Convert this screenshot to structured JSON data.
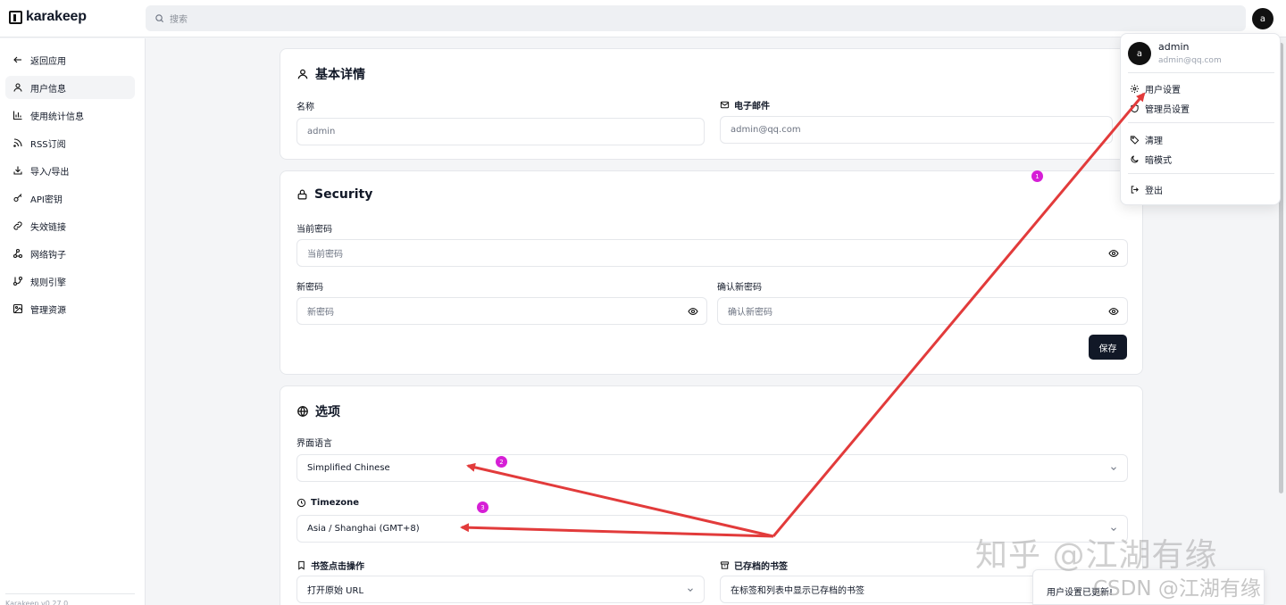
{
  "app": {
    "name": "karakeep"
  },
  "search": {
    "placeholder": "搜索"
  },
  "user": {
    "initial": "a",
    "name": "admin",
    "email": "admin@qq.com"
  },
  "sidebar": {
    "items": [
      {
        "label": "返回应用",
        "icon": "arrow-left-icon"
      },
      {
        "label": "用户信息",
        "icon": "user-icon",
        "active": true
      },
      {
        "label": "使用统计信息",
        "icon": "bar-chart-icon"
      },
      {
        "label": "RSS订阅",
        "icon": "rss-icon"
      },
      {
        "label": "导入/导出",
        "icon": "download-icon"
      },
      {
        "label": "API密钥",
        "icon": "key-icon"
      },
      {
        "label": "失效链接",
        "icon": "link-icon"
      },
      {
        "label": "网络钩子",
        "icon": "webhook-icon"
      },
      {
        "label": "规则引擎",
        "icon": "git-branch-icon"
      },
      {
        "label": "管理资源",
        "icon": "image-icon"
      }
    ],
    "footer": "Karakeep v0.27.0"
  },
  "basic": {
    "title": "基本详情",
    "name_label": "名称",
    "name_value": "admin",
    "email_label": "电子邮件",
    "email_value": "admin@qq.com"
  },
  "security": {
    "title": "Security",
    "current_label": "当前密码",
    "current_placeholder": "当前密码",
    "new_label": "新密码",
    "new_placeholder": "新密码",
    "confirm_label": "确认新密码",
    "confirm_placeholder": "确认新密码",
    "save_label": "保存"
  },
  "options": {
    "title": "选项",
    "language_label": "界面语言",
    "language_value": "Simplified Chinese",
    "timezone_label": "Timezone",
    "timezone_value": "Asia / Shanghai (GMT+8)",
    "click_label": "书签点击操作",
    "click_value": "打开原始 URL",
    "archived_label": "已存档的书签",
    "archived_value": "在标签和列表中显示已存档的书签"
  },
  "menu": {
    "items": [
      {
        "label": "用户设置",
        "icon": "gear-icon"
      },
      {
        "label": "管理员设置",
        "icon": "shield-icon"
      },
      {
        "label": "清理",
        "icon": "tag-icon"
      },
      {
        "label": "暗模式",
        "icon": "moon-icon"
      },
      {
        "label": "登出",
        "icon": "logout-icon"
      }
    ]
  },
  "annotations": {
    "badges": [
      "1",
      "2",
      "3"
    ],
    "arrow_color": "#e23b3b",
    "badge_color": "#d61fd6"
  },
  "toast": {
    "message": "用户设置已更新!"
  },
  "watermark": {
    "main": "知乎 @江湖有缘",
    "csdn": "CSDN @江湖有缘"
  }
}
